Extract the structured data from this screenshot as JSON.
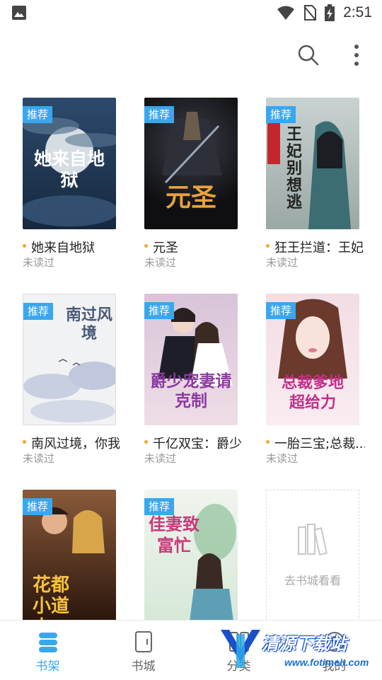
{
  "status_bar": {
    "time": "2:51"
  },
  "books": [
    {
      "badge": "推荐",
      "cover_text": "她来自地狱",
      "title": "她来自地狱",
      "status": "未读过",
      "bg": "#1f3450"
    },
    {
      "badge": "推荐",
      "cover_text": "元圣",
      "title": "元圣",
      "status": "未读过",
      "bg": "#1b1a1c"
    },
    {
      "badge": "推荐",
      "cover_text": "王妃别想逃",
      "title": "狂王拦道：王妃",
      "status": "未读过",
      "bg": "#b7c2c2"
    },
    {
      "badge": "推荐",
      "cover_text": "南过风境",
      "title": "南风过境，你我",
      "status": "未读过",
      "bg": "#eef0f3"
    },
    {
      "badge": "推荐",
      "cover_text": "爵少宠妻请克制",
      "title": "千亿双宝：爵少",
      "status": "未读过",
      "bg": "#e7c9d9"
    },
    {
      "badge": "推荐",
      "cover_text": "总裁爹地超给力",
      "title": "一胎三宝;总裁...",
      "status": "未读过",
      "bg": "#f1d3dd"
    },
    {
      "badge": "推荐",
      "cover_text": "花都小道士",
      "title": "",
      "status": "",
      "bg": "#4a2a1a"
    },
    {
      "badge": "推荐",
      "cover_text": "佳妻致富忙",
      "title": "",
      "status": "",
      "bg": "#e4efe6"
    }
  ],
  "goto_store": {
    "label": "去书城看看"
  },
  "bottom_nav": [
    {
      "label": "书架",
      "active": true
    },
    {
      "label": "书城",
      "active": false
    },
    {
      "label": "分类",
      "active": false
    },
    {
      "label": "我的",
      "active": false
    }
  ],
  "watermark": {
    "text": "清源下载站",
    "url": "www.fotimeit.com"
  },
  "colors": {
    "accent": "#39a7ee",
    "dot": "#f5a623"
  }
}
